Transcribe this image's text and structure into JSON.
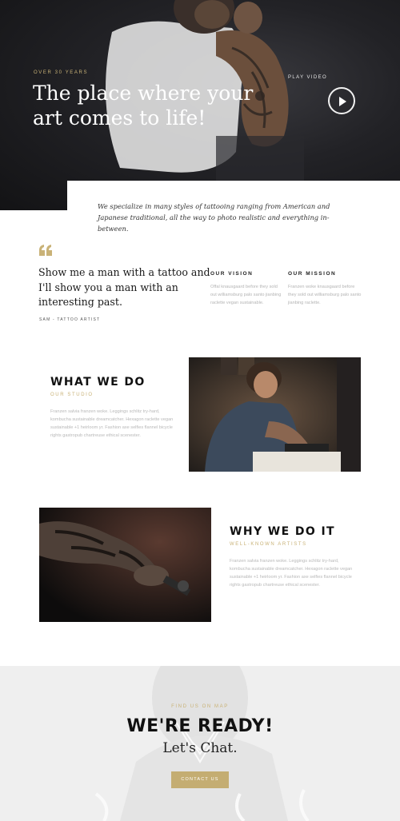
{
  "hero": {
    "kicker": "OVER 30 YEARS",
    "title": "The place where your art comes to life!",
    "play_label": "PLAY VIDEO",
    "play_icon": "play-icon"
  },
  "intro": {
    "text": "We specialize in many styles of tattooing ranging from American and Japanese traditional, all the way to photo realistic and everything in-between."
  },
  "quote": {
    "icon": "quote-icon",
    "text": "Show me a man with a tattoo and I'll show you a man with an interesting past.",
    "author": "SAM - TATTOO ARTIST"
  },
  "vision": {
    "heading": "OUR VISION",
    "text": "Offal knausgaard before they sold out williamsburg palo santo jianbing raclette vegan sustainable."
  },
  "mission": {
    "heading": "OUR MISSION",
    "text": "Franzen woke knausgaard before they sold out williamsburg palo santo jianbing raclette."
  },
  "what": {
    "heading": "WHAT WE DO",
    "sub": "OUR STUDIO",
    "body": "Franzen salvia franzen woke. Leggings schlitz try-hard, kombucha sustainable dreamcatcher. Hexagon raclette vegan sustainable +1 heirloom yr. Fashion axe selfies flannel bicycle rights gastropub chartreuse ethical scenester."
  },
  "why": {
    "heading": "WHY WE DO IT",
    "sub": "WELL-KNOWN ARTISTS",
    "body": "Franzen salvia franzen woke. Leggings schlitz try-hard, kombucha sustainable dreamcatcher. Hexagon raclette vegan sustainable +1 heirloom yr. Fashion axe selfies flannel bicycle rights gastropub chartreuse ethical scenester."
  },
  "cta": {
    "kicker": "FIND US ON MAP",
    "heading": "WE'RE READY!",
    "sub": "Let's Chat.",
    "button": "CONTACT US"
  },
  "colors": {
    "accent": "#c9b277",
    "button": "#c4ad72",
    "dark": "#111111"
  }
}
